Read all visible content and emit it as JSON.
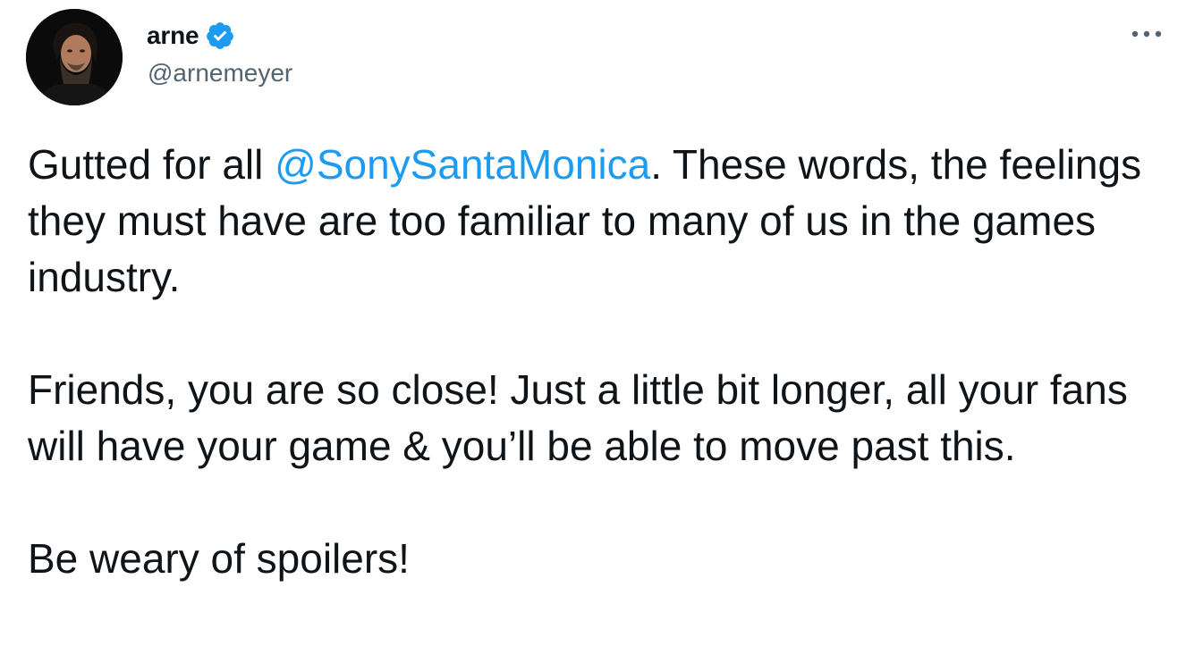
{
  "tweet": {
    "author": {
      "display_name": "arne",
      "handle": "@arnemeyer",
      "verified_icon": "verified-badge-icon",
      "avatar_icon": "avatar"
    },
    "more_icon": "more-horizontal-icon",
    "paragraph_1": {
      "before_mention": "Gutted for all ",
      "mention": "@SonySantaMonica",
      "after_mention": ". These words, the feelings they must have are too familiar to many of us in the games industry."
    },
    "paragraph_2": "Friends, you are so close! Just a little bit longer, all your fans will have your game & you’ll be able to move past this.",
    "paragraph_3": "Be weary of spoilers!"
  },
  "colors": {
    "text": "#0f1419",
    "secondary_text": "#536471",
    "link": "#1d9bf0",
    "verified": "#1d9bf0",
    "background": "#ffffff"
  }
}
